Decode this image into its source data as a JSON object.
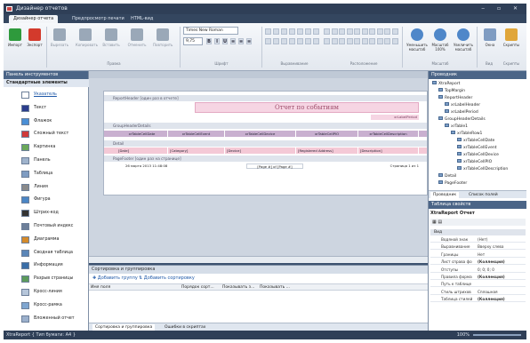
{
  "app": {
    "title": "Дизайнер отчетов",
    "window_controls": "‒ ▫ ✕"
  },
  "ribbon_tabs": [
    "Дизайнер отчета",
    "Предпросмотр печати",
    "HTML-вид"
  ],
  "ribbon": {
    "buttons_main": [
      {
        "label": "Импорт",
        "color": "#2e9a3c"
      },
      {
        "label": "Экспорт",
        "color": "#d33a2c"
      },
      {
        "label": "Вырезать",
        "color": "#9aa8b8"
      },
      {
        "label": "Копировать",
        "color": "#9aa8b8"
      },
      {
        "label": "Вставить",
        "color": "#9aa8b8"
      },
      {
        "label": "Отменить",
        "color": "#9aa8b8"
      },
      {
        "label": "Повторить",
        "color": "#9aa8b8"
      }
    ],
    "group_labels": [
      "Правка",
      "Шрифт",
      "Выравнивание",
      "Расположение",
      "Масштаб",
      "Вид",
      "Скрипты"
    ],
    "font_name": "Times New Roman",
    "font_size": "9,75",
    "format_buttons": [
      "B",
      "I",
      "U",
      "≡",
      "≡",
      "≡"
    ],
    "zoom_buttons": [
      {
        "label": "Уменьшить масштаб"
      },
      {
        "label": "Масштаб 100%"
      },
      {
        "label": "Увеличить масштаб"
      }
    ],
    "view_buttons": [
      {
        "label": "Окна"
      },
      {
        "label": "Скрипты"
      }
    ]
  },
  "toolbox": {
    "title": "Панель инструментов",
    "category": "Стандартные элементы",
    "items": [
      "Указатель",
      "Текст",
      "Флажок",
      "Сложный текст",
      "Картинка",
      "Панель",
      "Таблица",
      "Линия",
      "Фигура",
      "Штрих-код",
      "Почтовый индекс",
      "Диаграмма",
      "Сводная таблица",
      "Информация",
      "Разрыв страницы",
      "Кросс-линия",
      "Кросс-рамка",
      "Вложенный отчет"
    ]
  },
  "report": {
    "bands": [
      "ReportHeader [один раз в отчете]",
      "GroupHeaderDetails",
      "Detail",
      "PageFooter [один раз на странице]"
    ],
    "title": "Отчет по событиям",
    "label_period": "xrLabelPeriod",
    "header_cells": [
      "xrTableCellDate",
      "xrTableCellEvent",
      "xrTableCellDevice",
      "xrTableCellPIO",
      "xrTableCellDescription"
    ],
    "detail_cells": [
      "[Date]",
      "[Category]",
      "[Device]",
      "[Registered Address]",
      "[Description]"
    ],
    "footer_left": "26 марта 2013 11:48:08",
    "footer_center": "[Page #] of [Page #]",
    "footer_right": "Страница 1 из 1"
  },
  "sort_panel": {
    "title": "Сортировка и группировка",
    "add_group": "Добавить группу",
    "add_sort": "Добавить сортировку",
    "columns": [
      "Имя поля",
      "Порядок сорт...",
      "Показывать з...",
      "Показывать ..."
    ],
    "tabs": [
      "Сортировка и группировка",
      "Ошибки в скриптах"
    ]
  },
  "report_tree": {
    "title": "Проводник",
    "nodes": [
      "XtraReport",
      "TopMargin",
      "ReportHeader",
      "xrLabelHeader",
      "xrLabelPeriod",
      "GroupHeaderDetails",
      "xrTable1",
      "xrTableRow1",
      "xrTableCellDate",
      "xrTableCellEvent",
      "xrTableCellDevice",
      "xrTableCellPIO",
      "xrTableCellDescription",
      "Detail",
      "PageFooter"
    ],
    "tabs": [
      "Проводник",
      "Список полей"
    ]
  },
  "properties": {
    "title": "Таблица свойств",
    "object": "XtraReport  Отчет",
    "section": "Вид",
    "rows": [
      {
        "k": "Водяной знак",
        "v": "(Нет)"
      },
      {
        "k": "Выравнивание",
        "v": "Вверху слева"
      },
      {
        "k": "Границы",
        "v": "Нет"
      },
      {
        "k": "Лист справа фо",
        "v": "(Коллекция)"
      },
      {
        "k": "Отступы",
        "v": "0; 0; 0; 0"
      },
      {
        "k": "Правила форма",
        "v": "(Коллекция)"
      },
      {
        "k": "Путь к таблице",
        "v": ""
      },
      {
        "k": "Стиль штрихов",
        "v": "Сплошная"
      },
      {
        "k": "Таблица стилей",
        "v": "(Коллекция)"
      }
    ]
  },
  "status": {
    "text": "XtraReport { Тип бумаги: A4 }",
    "zoom": "100%"
  }
}
